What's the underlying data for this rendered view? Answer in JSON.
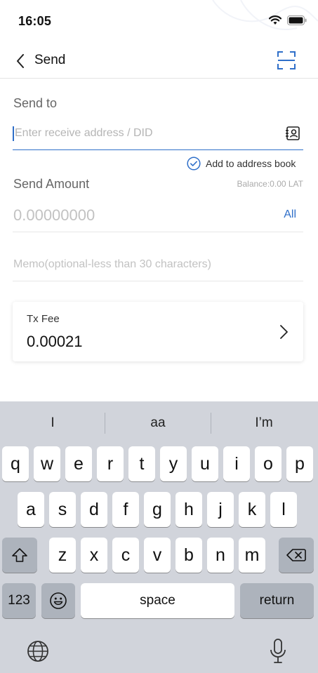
{
  "status_bar": {
    "time": "16:05"
  },
  "nav": {
    "title": "Send"
  },
  "send_to": {
    "label": "Send to",
    "address_placeholder": "Enter receive address / DID",
    "add_to_book_label": "Add to address book"
  },
  "amount": {
    "label": "Send Amount",
    "balance": "Balance:0.00 LAT",
    "placeholder": "0.00000000",
    "all_label": "All"
  },
  "memo": {
    "placeholder": "Memo(optional-less than 30 characters)"
  },
  "fee": {
    "label": "Tx Fee",
    "value": "0.00021"
  },
  "keyboard": {
    "suggestions": [
      "I",
      "aa",
      "I’m"
    ],
    "row1": [
      "q",
      "w",
      "e",
      "r",
      "t",
      "y",
      "u",
      "i",
      "o",
      "p"
    ],
    "row2": [
      "a",
      "s",
      "d",
      "f",
      "g",
      "h",
      "j",
      "k",
      "l"
    ],
    "row3": [
      "z",
      "x",
      "c",
      "v",
      "b",
      "n",
      "m"
    ],
    "numbers_label": "123",
    "space_label": "space",
    "return_label": "return"
  },
  "colors": {
    "accent": "#2f6fc9",
    "keyboard_bg": "#d1d4db"
  },
  "icons": [
    "back-icon",
    "scan-icon",
    "contacts-icon",
    "check-circle-icon",
    "chevron-right-icon",
    "shift-icon",
    "delete-icon",
    "emoji-icon",
    "globe-icon",
    "microphone-icon",
    "wifi-icon",
    "battery-icon"
  ]
}
